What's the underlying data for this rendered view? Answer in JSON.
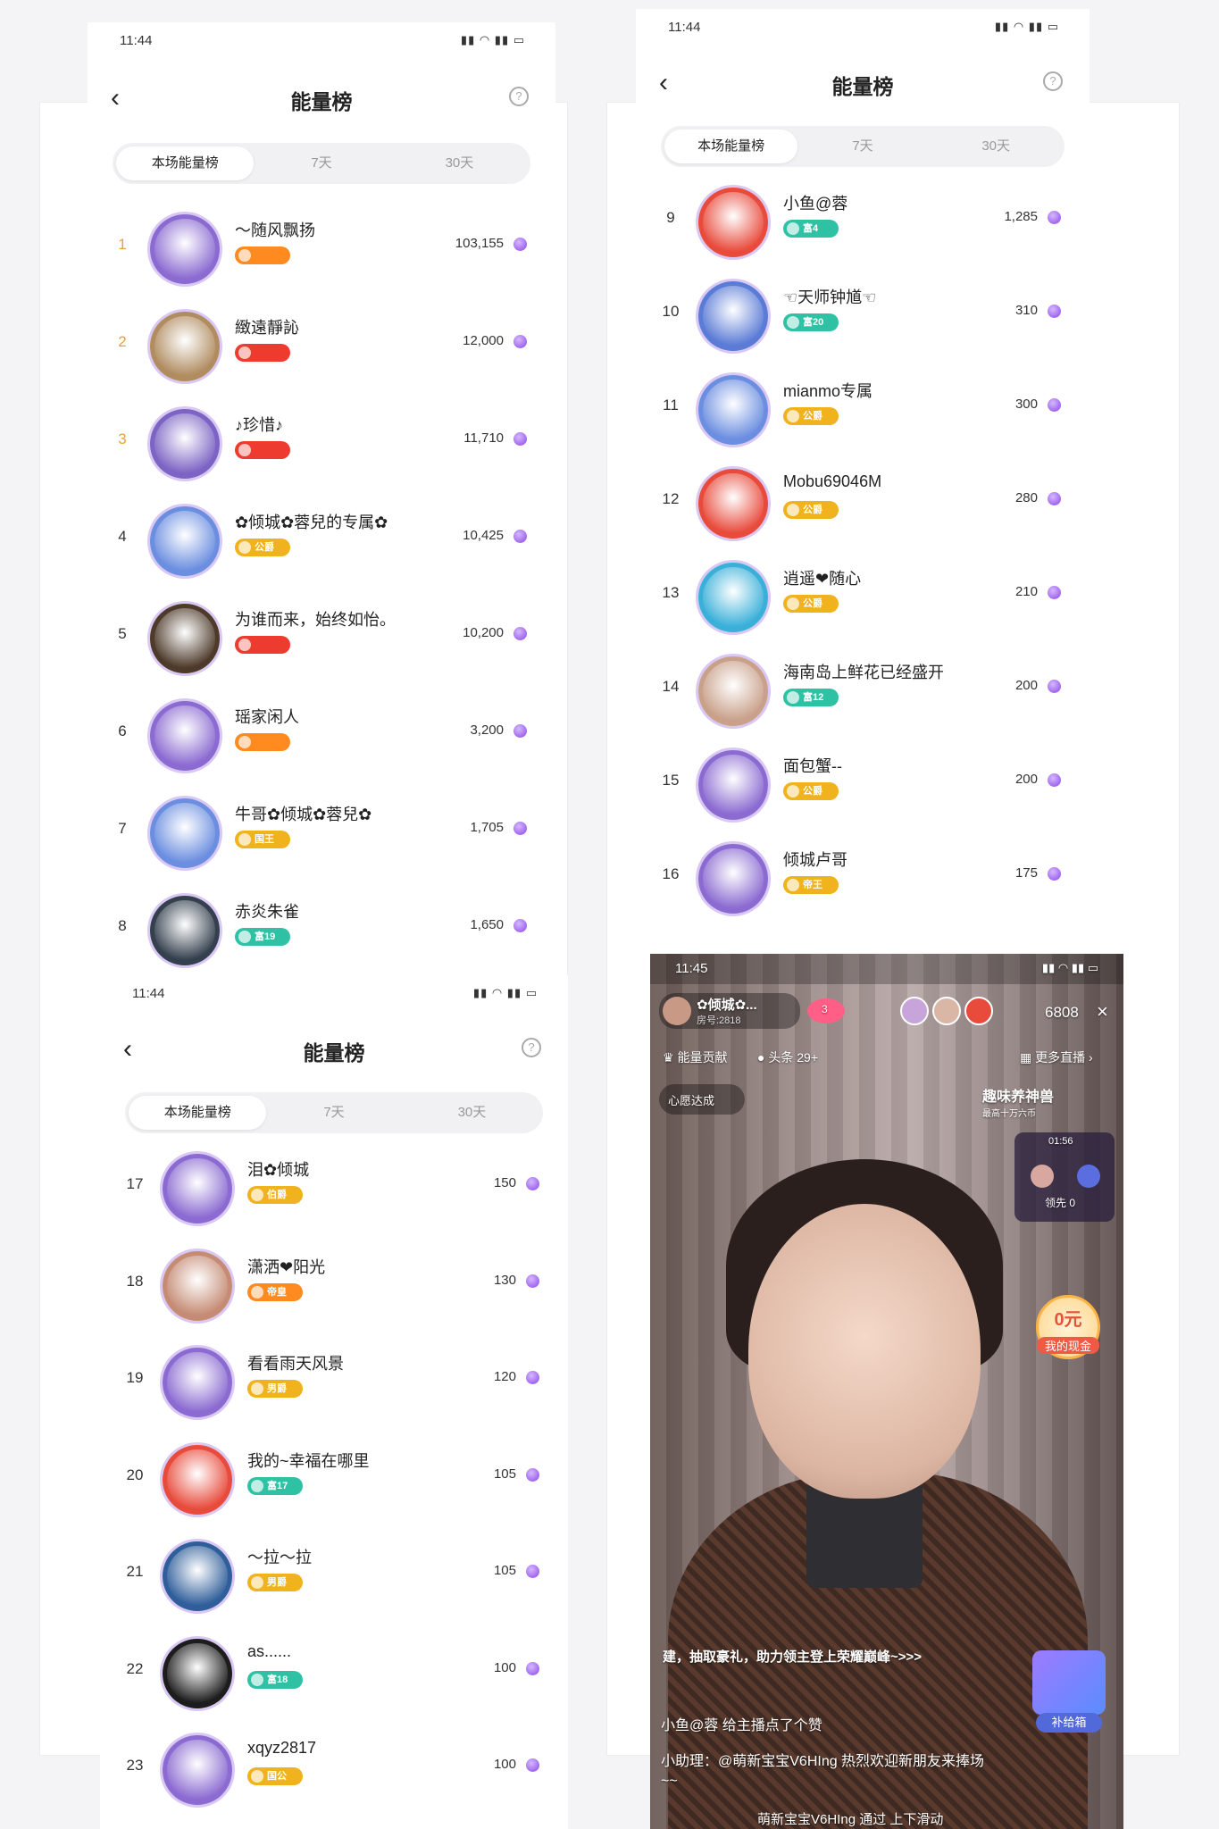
{
  "common": {
    "title": "能量榜",
    "tabs": [
      "本场能量榜",
      "7天",
      "30天"
    ],
    "help": "?",
    "back": "‹"
  },
  "panels": [
    {
      "time": "11:44",
      "rows": [
        {
          "rank": "1",
          "name": "～随风飘扬",
          "badge": "",
          "score": "103,155",
          "color": "#ff8a1f",
          "av": "#8b6bd1"
        },
        {
          "rank": "2",
          "name": "緻遠靜訫",
          "badge": "",
          "score": "12,000",
          "color": "#ee3b2f",
          "av": "#b08c60"
        },
        {
          "rank": "3",
          "name": "♪珍惜♪",
          "badge": "",
          "score": "11,710",
          "color": "#ee3b2f",
          "av": "#7c64c4"
        },
        {
          "rank": "4",
          "name": "✿倾城✿蓉兒的专属✿",
          "badge": "公爵",
          "score": "10,425",
          "color": "#f0b21d",
          "av": "#6b8ee0"
        },
        {
          "rank": "5",
          "name": "为谁而来，始终如怡。",
          "badge": "",
          "score": "10,200",
          "color": "#ee3b2f",
          "av": "#4d3a2a"
        },
        {
          "rank": "6",
          "name": "瑶家闲人",
          "badge": "",
          "score": "3,200",
          "color": "#ff8a1f",
          "av": "#8b6bd1"
        },
        {
          "rank": "7",
          "name": "牛哥✿倾城✿蓉兒✿",
          "badge": "国王",
          "score": "1,705",
          "color": "#f0b21d",
          "av": "#6b8ee0"
        },
        {
          "rank": "8",
          "name": "赤炎朱雀",
          "badge": "富19",
          "score": "1,650",
          "color": "#2fc1a4",
          "av": "#34404e"
        }
      ]
    },
    {
      "time": "11:44",
      "rows": [
        {
          "rank": "9",
          "name": "小鱼@蓉",
          "badge": "富4",
          "score": "1,285",
          "color": "#2fc1a4",
          "av": "#e84b3c"
        },
        {
          "rank": "10",
          "name": "☜天师钟馗☜",
          "badge": "富20",
          "score": "310",
          "color": "#2fc1a4",
          "av": "#5a7bd6"
        },
        {
          "rank": "11",
          "name": "mianmo专属",
          "badge": "公爵",
          "score": "300",
          "color": "#f0b21d",
          "av": "#6b8ee0"
        },
        {
          "rank": "12",
          "name": "Mobu69046M",
          "badge": "公爵",
          "score": "280",
          "color": "#f0b21d",
          "av": "#e84b3c"
        },
        {
          "rank": "13",
          "name": "逍遥❤随心",
          "badge": "公爵",
          "score": "210",
          "color": "#f0b21d",
          "av": "#3ab0d9"
        },
        {
          "rank": "14",
          "name": "海南岛上鲜花已经盛开",
          "badge": "富12",
          "score": "200",
          "color": "#2fc1a4",
          "av": "#c9a08a"
        },
        {
          "rank": "15",
          "name": "面包蟹--",
          "badge": "公爵",
          "score": "200",
          "color": "#f0b21d",
          "av": "#8b6bd1"
        },
        {
          "rank": "16",
          "name": "倾城卢哥",
          "badge": "帝王",
          "score": "175",
          "color": "#f0b21d",
          "av": "#8b6bd1"
        }
      ]
    },
    {
      "time": "11:44",
      "rows": [
        {
          "rank": "17",
          "name": "泪✿倾城",
          "badge": "伯爵",
          "score": "150",
          "color": "#f0b21d",
          "av": "#8b6bd1"
        },
        {
          "rank": "18",
          "name": "潇洒❤阳光",
          "badge": "帝皇",
          "score": "130",
          "color": "#ff8a1f",
          "av": "#c58b74"
        },
        {
          "rank": "19",
          "name": "看看雨天风景",
          "badge": "男爵",
          "score": "120",
          "color": "#f0b21d",
          "av": "#8b6bd1"
        },
        {
          "rank": "20",
          "name": "我的~幸福在哪里",
          "badge": "富17",
          "score": "105",
          "color": "#2fc1a4",
          "av": "#e84b3c"
        },
        {
          "rank": "21",
          "name": "～拉～拉",
          "badge": "男爵",
          "score": "105",
          "color": "#f0b21d",
          "av": "#2f5e9a"
        },
        {
          "rank": "22",
          "name": "as......",
          "badge": "富18",
          "score": "100",
          "color": "#2fc1a4",
          "av": "#1d1d1d"
        },
        {
          "rank": "23",
          "name": "xqyz2817",
          "badge": "国公",
          "score": "100",
          "color": "#f0b21d",
          "av": "#8b6bd1"
        }
      ]
    }
  ],
  "live": {
    "time": "11:45",
    "host": "✿倾城✿...",
    "room": "房号:2818",
    "likes": "3",
    "viewers": "6808",
    "energy": "能量贡献",
    "headline": "头条 29+",
    "more": "更多直播",
    "wish": "心愿达成",
    "game": "趣味养神兽",
    "game_sub": "最高十万六币",
    "pk_time": "01:56",
    "pk_lead": "领先 0",
    "cash_amt": "0元",
    "cash_lbl": "我的现金",
    "msg1": "建，抽取豪礼，助力领主登上荣耀巅峰~>>>",
    "msg2": "小鱼@蓉  给主播点了个赞",
    "msg3": "小助理：@萌新宝宝V6HIng 热烈欢迎新朋友来捧场~~",
    "msg4": "萌新宝宝V6HIng 通过 上下滑动",
    "box": "补给箱"
  }
}
